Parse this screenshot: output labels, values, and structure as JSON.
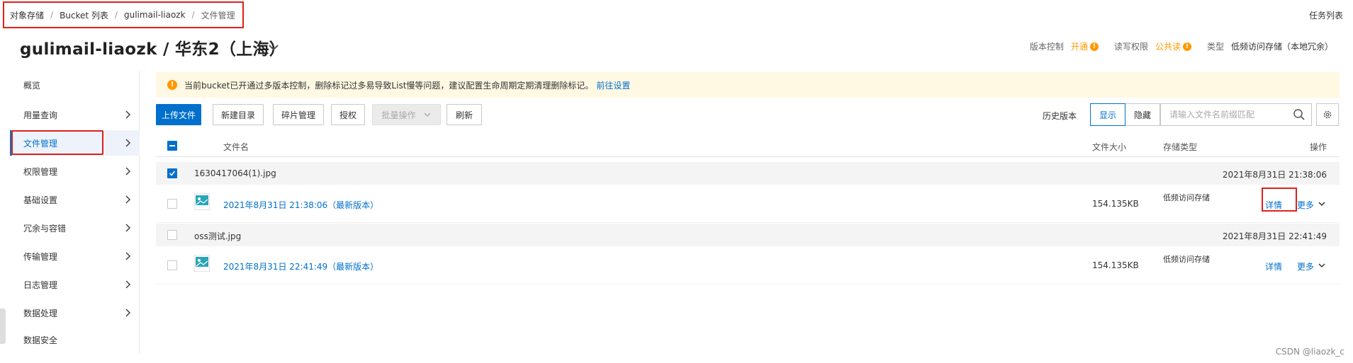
{
  "breadcrumb": {
    "items": [
      "对象存储",
      "Bucket 列表",
      "gulimail-liaozk",
      "文件管理"
    ]
  },
  "task_list": "任务列表",
  "title": "gulimail-liaozk / 华东2（上海）",
  "meta": {
    "version_label": "版本控制",
    "version_value": "开通",
    "rw_label": "读写权限",
    "rw_value": "公共读",
    "type_label": "类型",
    "type_value": "低频访问存储（本地冗余）"
  },
  "sidebar": {
    "items": [
      {
        "label": "概览"
      },
      {
        "label": "用量查询"
      },
      {
        "label": "文件管理"
      },
      {
        "label": "权限管理"
      },
      {
        "label": "基础设置"
      },
      {
        "label": "冗余与容错"
      },
      {
        "label": "传输管理"
      },
      {
        "label": "日志管理"
      },
      {
        "label": "数据处理"
      },
      {
        "label": "数据安全"
      }
    ]
  },
  "notice": {
    "text": "当前bucket已开通过多版本控制，删除标记过多易导致List慢等问题，建议配置生命周期定期清理删除标记。",
    "link": "前往设置"
  },
  "toolbar": {
    "upload": "上传文件",
    "new_dir": "新建目录",
    "fragments": "碎片管理",
    "authorize": "授权",
    "batch": "批量操作",
    "refresh": "刷新",
    "history_label": "历史版本",
    "show": "显示",
    "hide": "隐藏",
    "search_placeholder": "请输入文件名前缀匹配"
  },
  "table": {
    "headers": {
      "name": "文件名",
      "size": "文件大小",
      "storage": "存储类型",
      "action": "操作"
    },
    "groups": [
      {
        "name": "1630417064(1).jpg",
        "time": "2021年8月31日 21:38:06",
        "version": {
          "link": "2021年8月31日 21:38:06（最新版本）",
          "size": "154.135KB",
          "storage": "低频访问存储",
          "detail": "详情",
          "more": "更多"
        }
      },
      {
        "name": "oss测试.jpg",
        "time": "2021年8月31日 22:41:49",
        "version": {
          "link": "2021年8月31日 22:41:49（最新版本）",
          "size": "154.135KB",
          "storage": "低频访问存储",
          "detail": "详情",
          "more": "更多"
        }
      }
    ]
  },
  "watermark": "CSDN @liaozk_c"
}
